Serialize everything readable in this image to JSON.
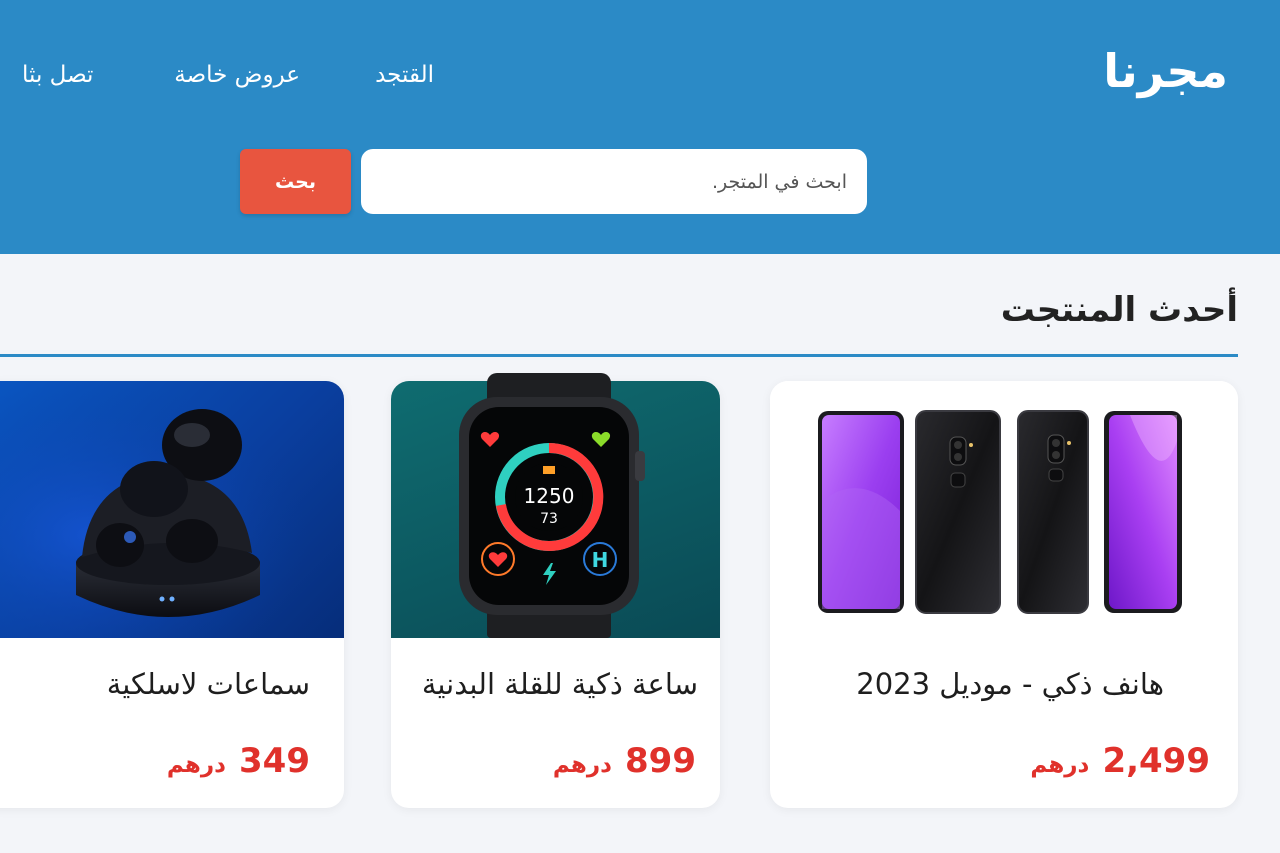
{
  "header": {
    "logo": "مجرنا",
    "nav": {
      "store": "القتجد",
      "offers": "عروض خاصة",
      "contact": "تصل بثا"
    },
    "search": {
      "placeholder": "ابحث في المتجر.",
      "button_label": "بحث"
    }
  },
  "colors": {
    "header_bg": "#2b8ac6",
    "accent_red": "#e8553f",
    "price_red": "#e0312b"
  },
  "main": {
    "section_title": "أحدث المنتجت",
    "products": [
      {
        "name": "هانف ذكي - موديل 2023",
        "price": "2,499",
        "currency": "درهم",
        "image": "smartphones-image"
      },
      {
        "name": "ساعة ذكية للقلة البدنية",
        "price": "899",
        "currency": "درهم",
        "image": "smartwatch-image",
        "watch_screen": {
          "primary": "1250",
          "secondary": "73",
          "badge": "H"
        }
      },
      {
        "name": "سماعات لاسلكية",
        "price": "349",
        "currency": "درهم",
        "image": "wireless-earbuds-image"
      }
    ]
  }
}
